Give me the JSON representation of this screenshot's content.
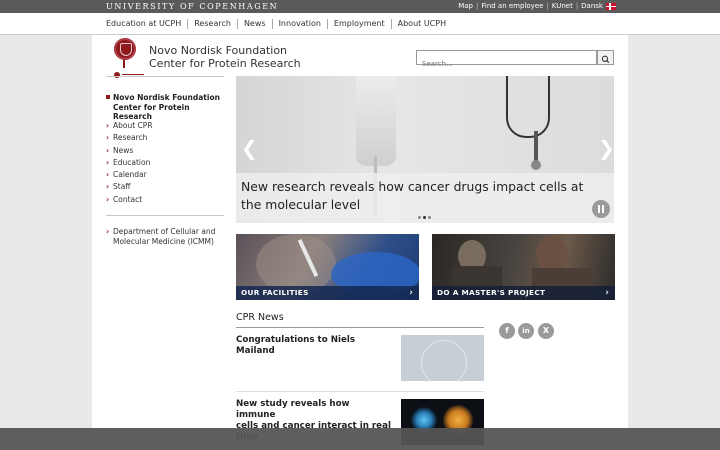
{
  "topbar": {
    "university": "UNIVERSITY OF COPENHAGEN",
    "links": [
      "Map",
      "Find an employee",
      "KUnet",
      "Dansk"
    ]
  },
  "nav": {
    "items": [
      "Education at UCPH",
      "Research",
      "News",
      "Innovation",
      "Employment",
      "About UCPH"
    ]
  },
  "header": {
    "title_line1": "Novo Nordisk Foundation",
    "title_line2": "Center for Protein Research"
  },
  "search": {
    "placeholder": "Search..."
  },
  "sidebar": {
    "active_line1": "Novo Nordisk Foundation",
    "active_line2": "Center for Protein Research",
    "items": [
      "About CPR",
      "Research",
      "News",
      "Education",
      "Calendar",
      "Staff",
      "Contact"
    ],
    "dept_line1": "Department of Cellular and",
    "dept_line2": "Molecular Medicine (ICMM)"
  },
  "hero": {
    "caption_line1": "New research reveals how cancer drugs impact cells at",
    "caption_line2": "the molecular level",
    "prev": "❮",
    "next": "❯"
  },
  "tiles": [
    {
      "label": "OUR FACILITIES",
      "arrow": "›"
    },
    {
      "label": "DO A MASTER'S PROJECT",
      "arrow": "›"
    }
  ],
  "news": {
    "heading": "CPR News",
    "items": [
      {
        "title": "Congratulations to Niels Mailand"
      },
      {
        "title_line1": "New study reveals how immune",
        "title_line2": "cells and cancer interact in real",
        "title_line3": "time"
      }
    ]
  },
  "social": [
    "f",
    "in",
    "X"
  ],
  "colors": {
    "brand_red": "#901a1e",
    "topbar": "#5a5a5a"
  }
}
